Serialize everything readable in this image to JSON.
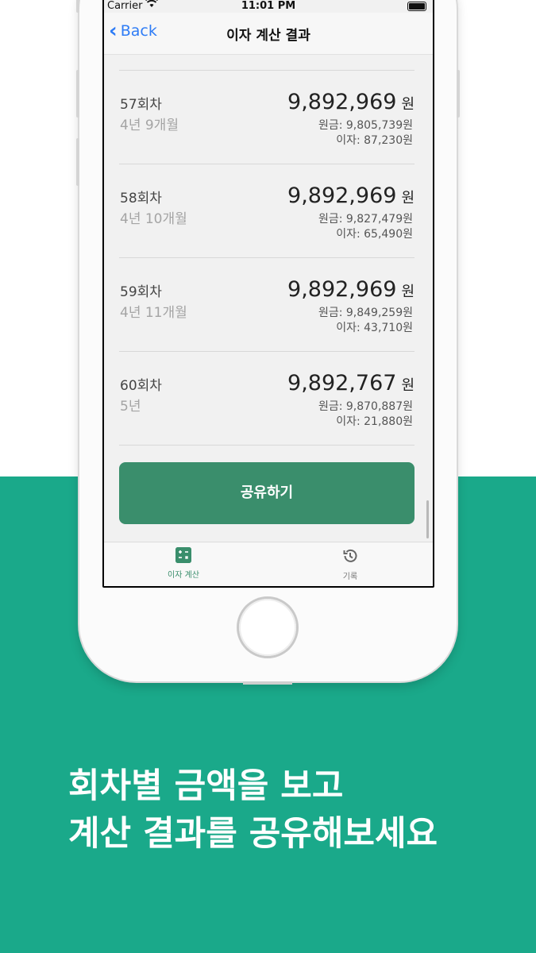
{
  "status": {
    "carrier": "Carrier",
    "time": "11:01 PM"
  },
  "navbar": {
    "back_label": "Back",
    "title": "이자 계산 결과"
  },
  "rows": [
    {
      "period": "57회차",
      "elapsed": "4년 9개월",
      "amount": "9,892,969",
      "unit": "원",
      "principal": "원금: 9,805,739원",
      "interest": "이자: 87,230원"
    },
    {
      "period": "58회차",
      "elapsed": "4년 10개월",
      "amount": "9,892,969",
      "unit": "원",
      "principal": "원금: 9,827,479원",
      "interest": "이자: 65,490원"
    },
    {
      "period": "59회차",
      "elapsed": "4년 11개월",
      "amount": "9,892,969",
      "unit": "원",
      "principal": "원금: 9,849,259원",
      "interest": "이자: 43,710원"
    },
    {
      "period": "60회차",
      "elapsed": "5년",
      "amount": "9,892,767",
      "unit": "원",
      "principal": "원금: 9,870,887원",
      "interest": "이자: 21,880원"
    }
  ],
  "share_button": "공유하기",
  "tabbar": {
    "calc_label": "이자 계산",
    "history_label": "기록"
  },
  "headline": {
    "line1": "회차별 금액을 보고",
    "line2": "계산 결과를 공유해보세요"
  },
  "colors": {
    "brand_green": "#1aa98a",
    "button_green": "#3a8e6c",
    "link_blue": "#2e7cf6"
  }
}
